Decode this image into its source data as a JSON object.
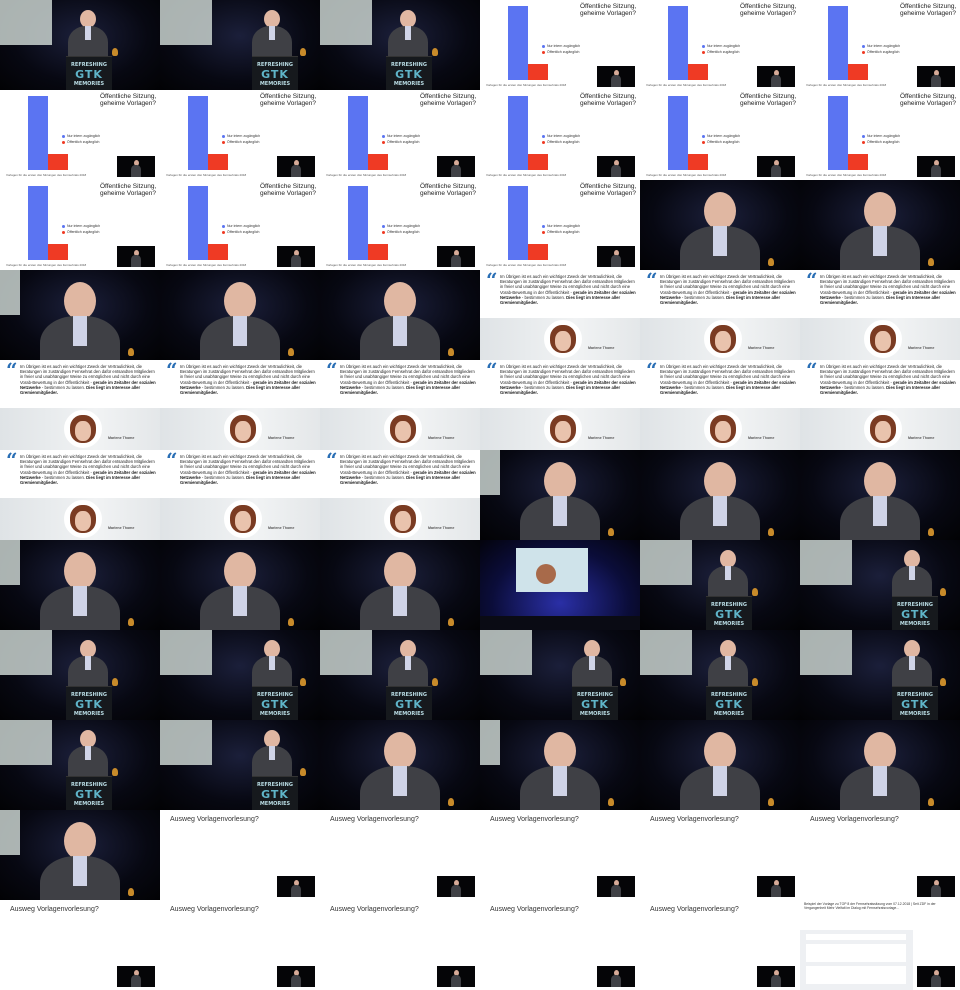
{
  "colors": {
    "accent_blue": "#5b74f2",
    "accent_red": "#ef3a24",
    "podium_logo": "#5fb4c8",
    "quote_mark": "#2a6fb5"
  },
  "podium": {
    "line1": "REFRESHING",
    "line2": "GTK",
    "line3": "MEMORIES"
  },
  "chart_slide": {
    "title_line1": "Öffentliche Sitzung,",
    "title_line2": "geheime Vorlagen?",
    "caption": "Vorlagen für die ersten drei Sitzungen des Fernsehrats 2018",
    "legend": [
      "Nur intern zugänglich",
      "Öffentlich zugänglich"
    ],
    "chart_data": {
      "type": "bar",
      "categories": [
        "Nur intern zugänglich",
        "Öffentlich zugänglich"
      ],
      "values": [
        100,
        22
      ],
      "ylim": [
        0,
        100
      ]
    }
  },
  "quote_slide": {
    "text_plain": "Im Übrigen ist es auch ein wichtiger Zweck der Vertraulichkeit, die Beratungen im zuständigen Fernsehrat den dafür entsandten Mitgliedern in freier und unabhängiger Weise zu ermöglichen und nicht durch eine Vorab-Bewertung in der Öffentlichkeit -",
    "text_bold1": "gerade im Zeitalter der sozialen Netzwerke",
    "text_mid": "- bestimmen zu lassen.",
    "text_bold2": "Dies liegt im Interesse aller Gremienmitglieder.",
    "name": "Marlene Thome"
  },
  "ausweg_slide": {
    "title": "Ausweg Vorlagenvorlesung?"
  },
  "final_slide": {
    "text": "Beispiel der Vorlage zu TOP 8 der Fernsehratssitzung vom 07.12.2018 | Seit ZDF in der Vergangenheit Mehr Vielfalt im Dialog mit Fernsehratsvorlage..."
  },
  "grid": [
    [
      "podium",
      "podium",
      "podium",
      "chart",
      "chart",
      "chart"
    ],
    [
      "chart",
      "chart",
      "chart",
      "chart",
      "chart",
      "chart"
    ],
    [
      "chart",
      "chart",
      "chart",
      "chart",
      "close",
      "close"
    ],
    [
      "close",
      "close",
      "close",
      "quote",
      "quote",
      "quote"
    ],
    [
      "quote",
      "quote",
      "quote",
      "quote",
      "quote",
      "quote"
    ],
    [
      "quote",
      "quote",
      "quote",
      "close",
      "close",
      "close"
    ],
    [
      "close",
      "close",
      "close",
      "hall",
      "podium",
      "podium"
    ],
    [
      "podium",
      "podium",
      "podium",
      "podium",
      "podium",
      "podium"
    ],
    [
      "podium",
      "podium",
      "close",
      "close",
      "close",
      "close"
    ],
    [
      "close",
      "ausweg",
      "ausweg",
      "ausweg",
      "ausweg",
      "ausweg"
    ],
    [
      "ausweg",
      "ausweg",
      "ausweg",
      "ausweg",
      "ausweg",
      "final"
    ]
  ]
}
